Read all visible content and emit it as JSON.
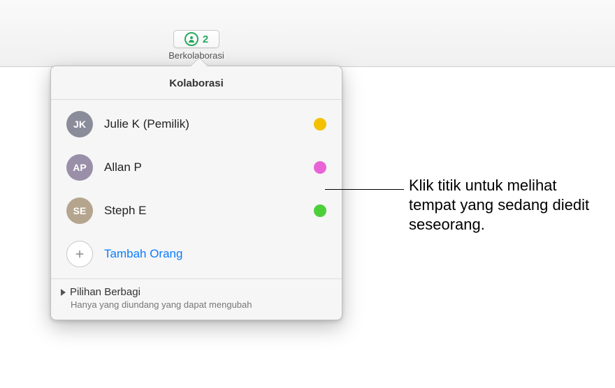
{
  "toolbar": {
    "count": "2",
    "label": "Berkolaborasi"
  },
  "popover": {
    "title": "Kolaborasi",
    "people": [
      {
        "initials": "JK",
        "name": "Julie K (Pemilik)",
        "avatarColor": "#8a8c9a",
        "dotColor": "#f2c200"
      },
      {
        "initials": "AP",
        "name": "Allan P",
        "avatarColor": "#9a8fa8",
        "dotColor": "#e864d6"
      },
      {
        "initials": "SE",
        "name": "Steph E",
        "avatarColor": "#b5a58e",
        "dotColor": "#4dcf3c"
      }
    ],
    "addLabel": "Tambah Orang",
    "options": {
      "title": "Pilihan Berbagi",
      "subtitle": "Hanya yang diundang yang dapat mengubah"
    }
  },
  "callout": "Klik titik untuk melihat tempat yang sedang diedit seseorang."
}
